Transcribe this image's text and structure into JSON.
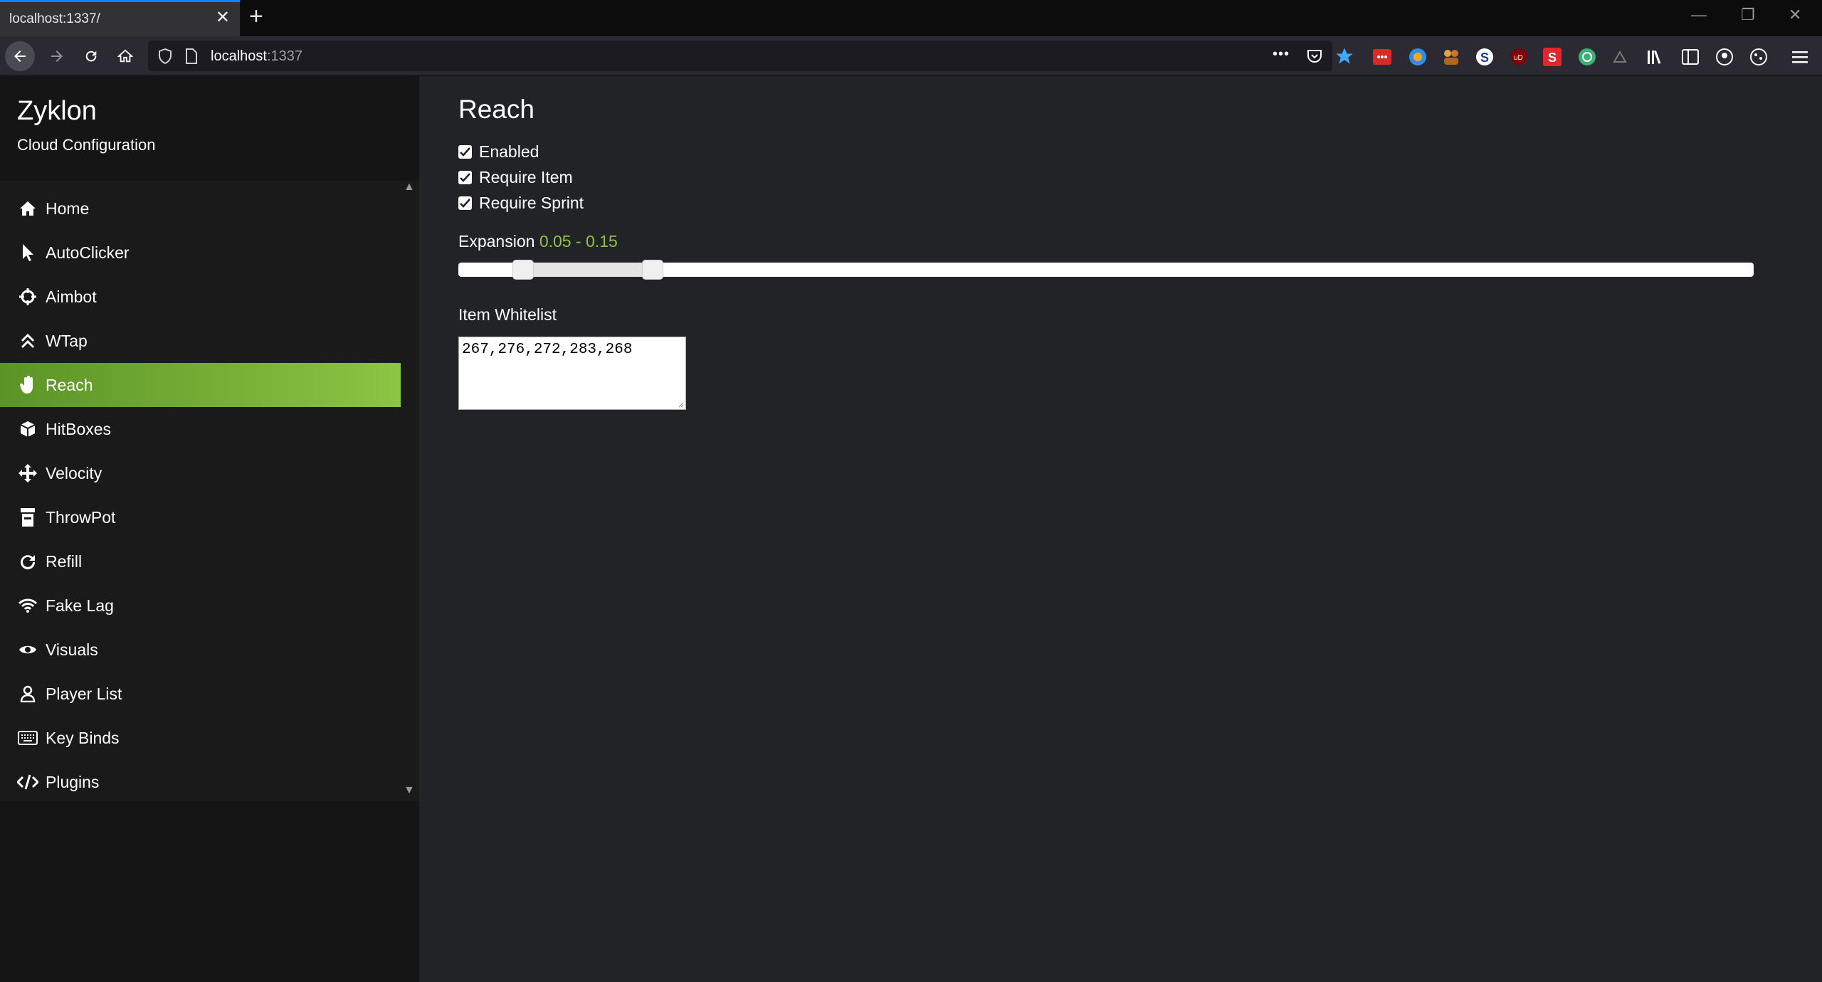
{
  "browser": {
    "tab_title": "localhost:1337/",
    "tab_close": "✕",
    "new_tab": "+",
    "window_controls": {
      "minimize": "—",
      "restore": "❐",
      "close": "✕"
    },
    "url_host": "localhost",
    "url_port": ":1337",
    "page_actions": "•••",
    "extensions": [
      "lastpass-icon",
      "globe-icon",
      "people-icon",
      "s-blue-icon",
      "ublock-icon",
      "s-red-icon",
      "refresh-green-icon",
      "dark-reader-icon",
      "library-icon",
      "sidebar-icon",
      "account-icon",
      "cookie-icon",
      "menu-icon"
    ]
  },
  "app": {
    "title": "Zyklon",
    "subtitle": "Cloud Configuration"
  },
  "sidebar": {
    "items": [
      {
        "label": "Home",
        "icon": "home-icon"
      },
      {
        "label": "AutoClicker",
        "icon": "pointer-icon"
      },
      {
        "label": "Aimbot",
        "icon": "crosshair-icon"
      },
      {
        "label": "WTap",
        "icon": "double-chevron-up-icon"
      },
      {
        "label": "Reach",
        "icon": "hand-icon",
        "active": true
      },
      {
        "label": "HitBoxes",
        "icon": "cube-icon"
      },
      {
        "label": "Velocity",
        "icon": "move-arrows-icon"
      },
      {
        "label": "ThrowPot",
        "icon": "prescription-bottle-icon"
      },
      {
        "label": "Refill",
        "icon": "redo-icon"
      },
      {
        "label": "Fake Lag",
        "icon": "wifi-icon"
      },
      {
        "label": "Visuals",
        "icon": "eye-icon"
      },
      {
        "label": "Player List",
        "icon": "user-icon"
      },
      {
        "label": "Key Binds",
        "icon": "keyboard-icon"
      },
      {
        "label": "Plugins",
        "icon": "code-icon"
      }
    ]
  },
  "main": {
    "title": "Reach",
    "checkboxes": [
      {
        "label": "Enabled",
        "checked": true
      },
      {
        "label": "Require Item",
        "checked": true
      },
      {
        "label": "Require Sprint",
        "checked": true
      }
    ],
    "expansion": {
      "label": "Expansion",
      "value_text": "0.05 - 0.15",
      "min_value": 0.05,
      "max_value": 0.15,
      "handle_low_fraction": 0.05,
      "handle_high_fraction": 0.15
    },
    "whitelist": {
      "label": "Item Whitelist",
      "value": "267,276,272,283,268"
    }
  },
  "colors": {
    "accent_start": "#5b9426",
    "accent_end": "#8cc443",
    "range_value": "#8cc443"
  }
}
